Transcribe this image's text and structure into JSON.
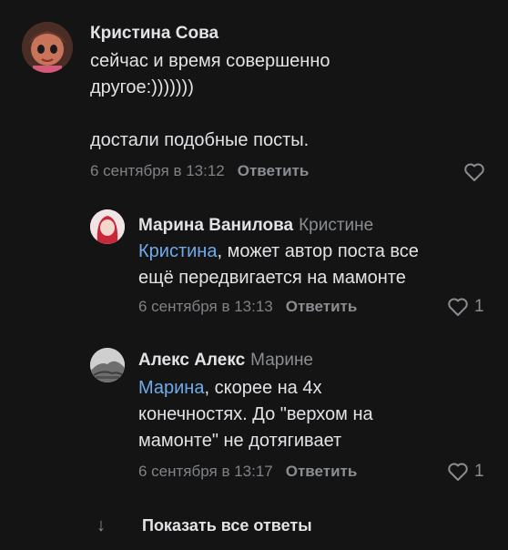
{
  "comments": [
    {
      "author": "Кристина Сова",
      "reply_to": "",
      "mention": "",
      "text_lines": [
        "сейчас и время совершенно",
        "другое:)))))))",
        "",
        "достали подобные посты."
      ],
      "date": "6 сентября в 13:12",
      "reply_label": "Ответить",
      "likes": ""
    },
    {
      "author": "Марина Ванилова",
      "reply_to": "Кристине",
      "mention": "Кристина",
      "text_first": ", может автор поста все",
      "text_rest": "ещё передвигается на мамонте",
      "date": "6 сентября в 13:13",
      "reply_label": "Ответить",
      "likes": "1"
    },
    {
      "author": "Алекс Алекс",
      "reply_to": "Марине",
      "mention": "Марина",
      "text_first": ", скорее на 4х",
      "text_rest": [
        "конечностях. До \"верхом на",
        "мамонте\" не дотягивает"
      ],
      "date": "6 сентября в 13:17",
      "reply_label": "Ответить",
      "likes": "1"
    }
  ],
  "show_all": {
    "arrow": "↓",
    "label": "Показать все ответы"
  },
  "icons": {
    "like": "heart-outline-icon",
    "arrow": "arrow-down-icon"
  },
  "colors": {
    "background": "#141414",
    "text": "#e1e3e6",
    "secondary": "#8a8d91",
    "mention": "#71aaeb"
  }
}
